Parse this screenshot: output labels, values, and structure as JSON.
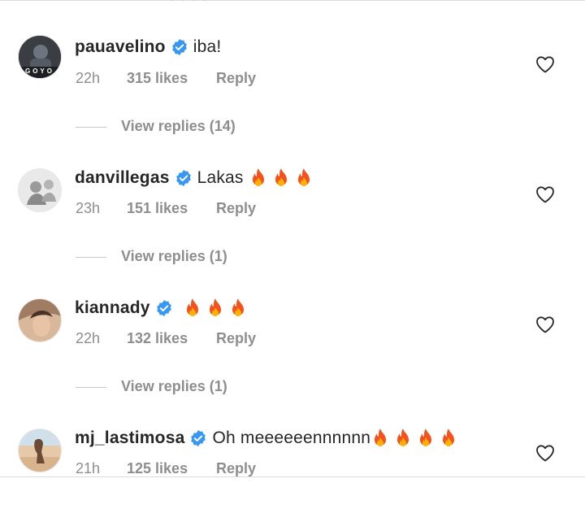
{
  "comments": [
    {
      "username": "pauavelino",
      "text": "iba!",
      "fires": 0,
      "time": "22h",
      "likes": "315 likes",
      "reply": "Reply",
      "avatar_text": "GOYO",
      "replies": "View replies (14)"
    },
    {
      "username": "danvillegas",
      "text": "Lakas",
      "fires": 3,
      "time": "23h",
      "likes": "151 likes",
      "reply": "Reply",
      "replies": "View replies (1)"
    },
    {
      "username": "kiannady",
      "text": "",
      "fires": 3,
      "time": "22h",
      "likes": "132 likes",
      "reply": "Reply",
      "replies": "View replies (1)"
    },
    {
      "username": "mj_lastimosa",
      "text": "Oh meeeeeennnnnn",
      "fires": 4,
      "time": "21h",
      "likes": "125 likes",
      "reply": "Reply"
    }
  ],
  "colors": {
    "verified": "#3897f0",
    "muted": "#8e8e8e",
    "text": "#262626"
  },
  "icons": {
    "verified": "verified-badge-icon",
    "heart": "heart-outline-icon",
    "fire": "fire-emoji-icon"
  }
}
